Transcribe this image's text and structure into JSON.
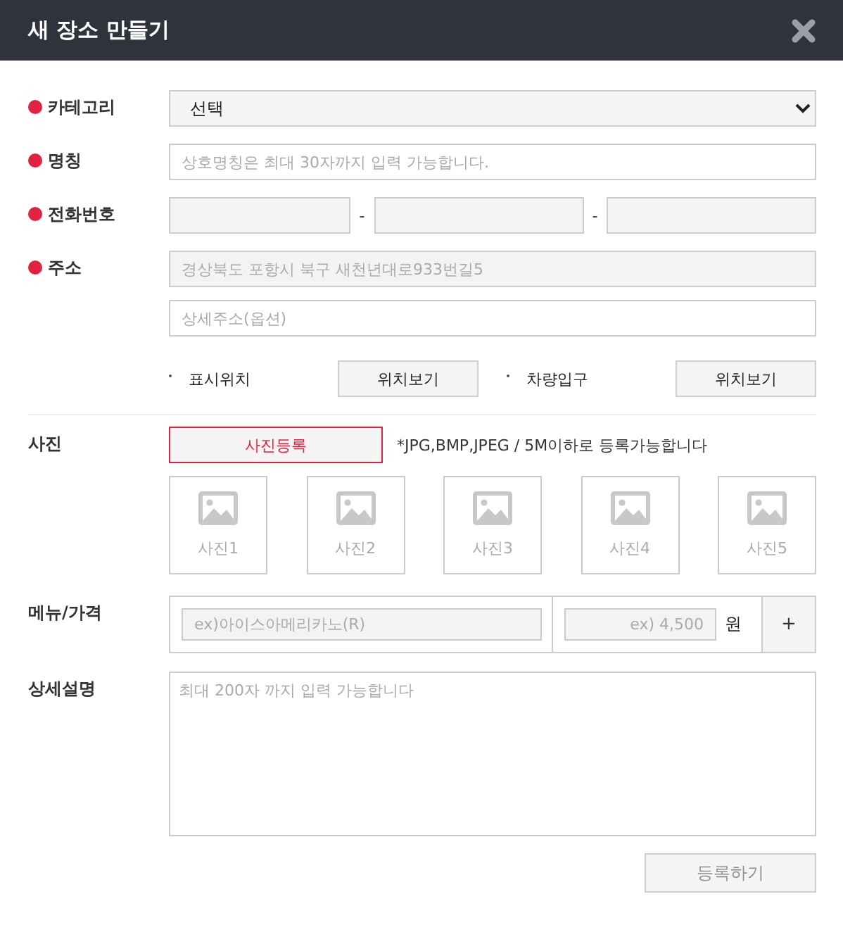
{
  "dialog": {
    "title": "새 장소 만들기"
  },
  "fields": [
    {
      "kind": "select",
      "label": "카테고리",
      "required": true,
      "value": "선택"
    },
    {
      "kind": "text",
      "label": "명칭",
      "required": true,
      "placeholder": "상호명칭은 최대 30자까지 입력 가능합니다."
    },
    {
      "kind": "phone",
      "label": "전화번호",
      "required": true,
      "separators": [
        "-",
        "-"
      ]
    },
    {
      "kind": "address",
      "label": "주소",
      "required": true,
      "value": "경상북도 포항시 북구 새천년대로933번길5",
      "disabled": true,
      "detail_placeholder": "상세주소(옵션)",
      "locations": [
        {
          "label": "표시위치",
          "button": "위치보기"
        },
        {
          "label": "차량입구",
          "button": "위치보기"
        }
      ]
    }
  ],
  "photo": {
    "label": "사진",
    "upload_button": "사진등록",
    "note": "*JPG,BMP,JPEG / 5M이하로 등록가능합니다",
    "slots": [
      "사진1",
      "사진2",
      "사진3",
      "사진4",
      "사진5"
    ]
  },
  "menu": {
    "label": "메뉴/가격",
    "name_placeholder": "ex)아이스아메리카노(R)",
    "price_placeholder": "ex) 4,500",
    "unit": "원",
    "add_button": "+"
  },
  "description": {
    "label": "상세설명",
    "placeholder": "최대 200자 까지 입력 가능합니다"
  },
  "submit": {
    "label": "등록하기",
    "disabled": true
  }
}
